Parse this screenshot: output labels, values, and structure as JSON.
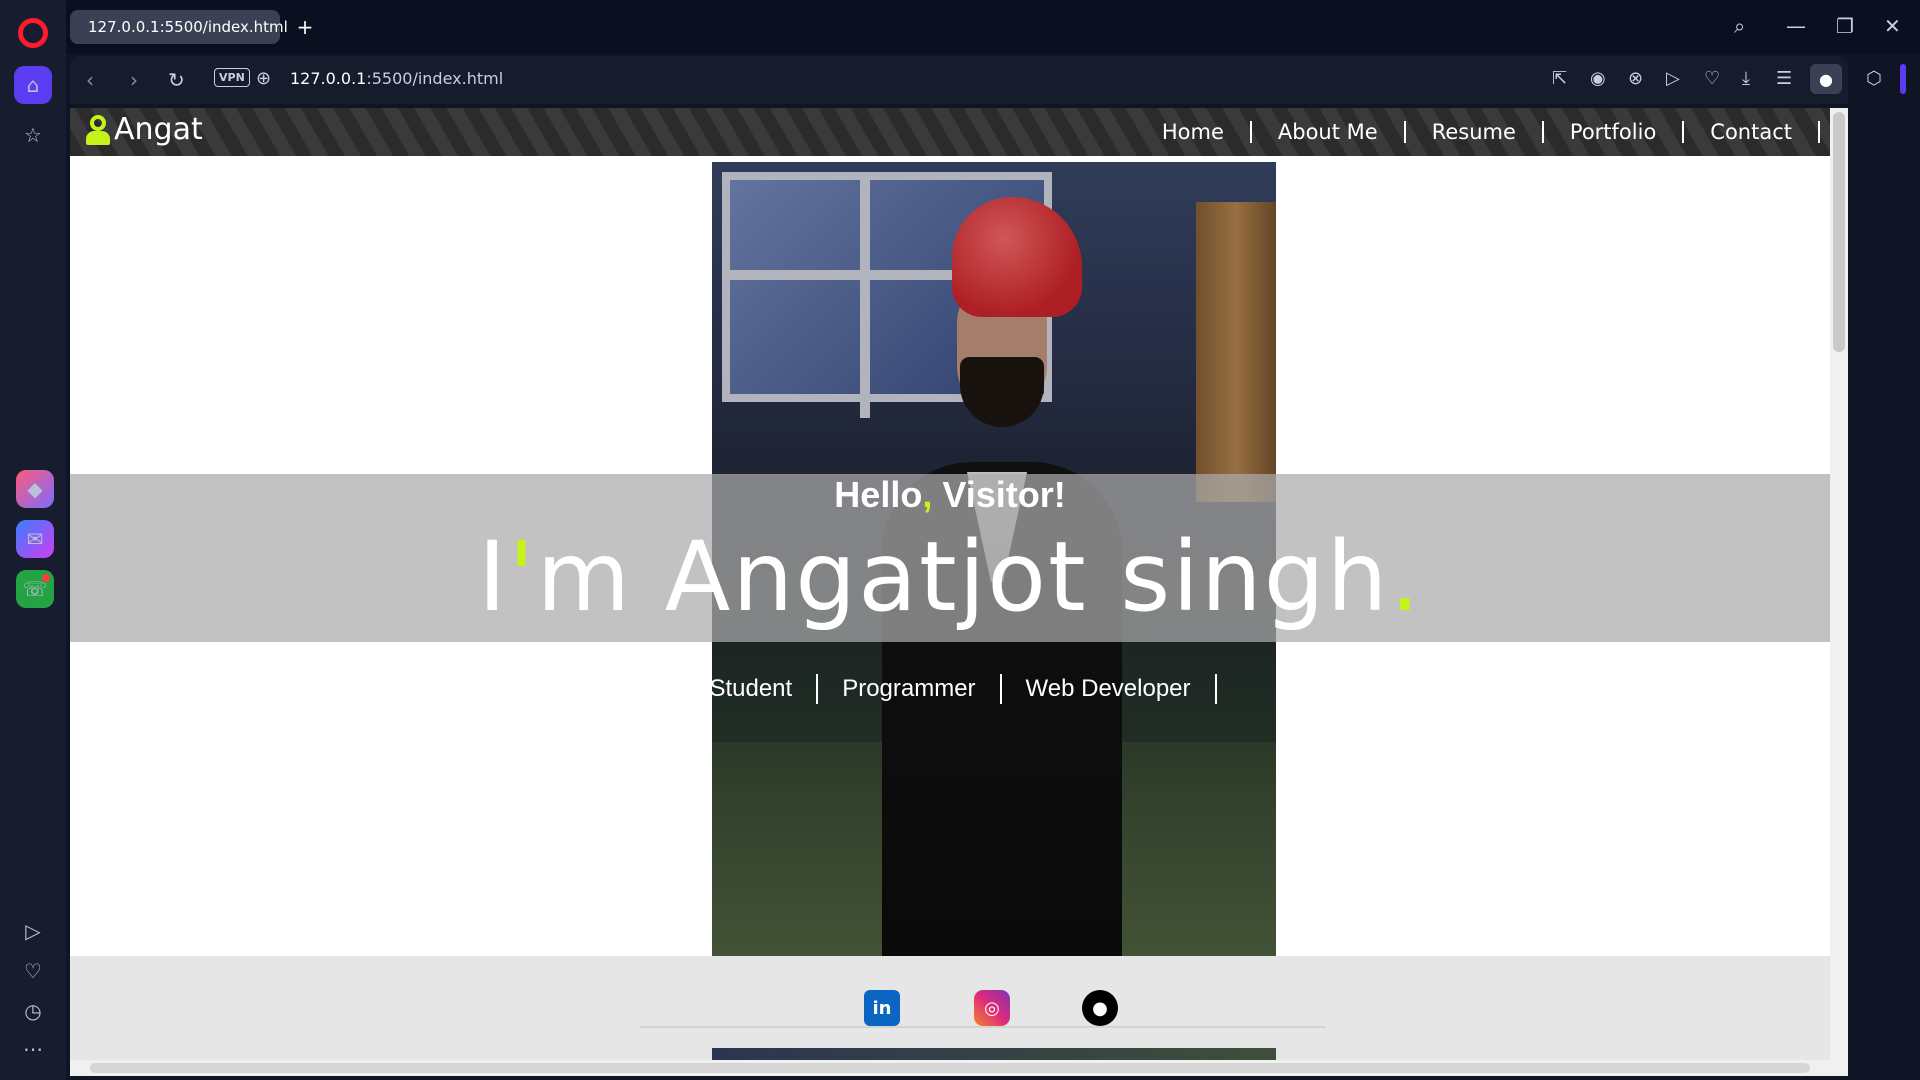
{
  "browser": {
    "tab_title": "127.0.0.1:5500/index.html",
    "new_tab": "+",
    "url_host": "127.0.0.1",
    "url_rest": ":5500/index.html",
    "vpn_label": "VPN"
  },
  "sidebar": {
    "items": [
      "home-icon",
      "star-icon",
      "aria-icon",
      "messenger-icon",
      "whatsapp-icon",
      "player-icon",
      "heart-icon",
      "history-icon",
      "more-icon"
    ]
  },
  "site": {
    "brand": "Angat",
    "nav": [
      "Home",
      "About Me",
      "Resume",
      "Portfolio",
      "Contact"
    ],
    "greeting": "Hello",
    "greeting_comma": ",",
    "greeting_rest": " Visitor!",
    "name_prefix": "I",
    "name_apostrophe": "'",
    "name_main": "m Angatjot singh",
    "name_dot": ".",
    "roles": [
      "Student",
      "Programmer",
      "Web Developer"
    ],
    "social": [
      "linkedin-icon",
      "instagram-icon",
      "github-icon"
    ],
    "social_li_text": "in"
  },
  "colors": {
    "accent": "#c6f21b",
    "opera_red": "#ff1b2d",
    "opera_purple": "#5b3cf0"
  }
}
